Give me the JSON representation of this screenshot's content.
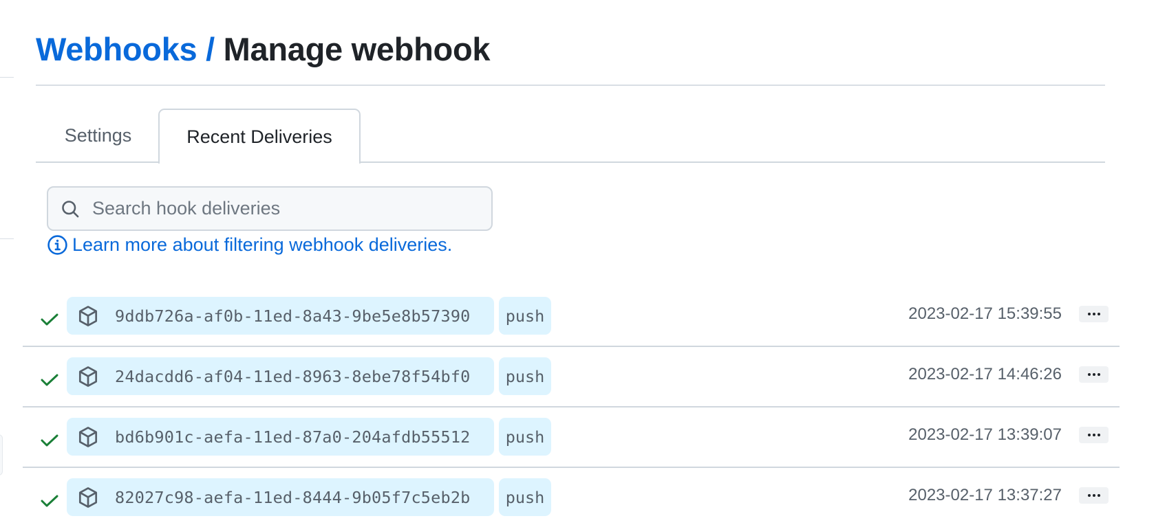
{
  "header": {
    "breadcrumb_parent": "Webhooks",
    "breadcrumb_separator": "/",
    "title": "Manage webhook"
  },
  "tabs": [
    {
      "label": "Settings",
      "active": false
    },
    {
      "label": "Recent Deliveries",
      "active": true
    }
  ],
  "search": {
    "placeholder": "Search hook deliveries",
    "value": ""
  },
  "help_link": {
    "label": "Learn more about filtering webhook deliveries.",
    "icon": "info-icon"
  },
  "deliveries": [
    {
      "status": "success",
      "status_icon": "check-icon",
      "type_icon": "package-icon",
      "guid": "9ddb726a-af0b-11ed-8a43-9be5e8b57390",
      "event": "push",
      "timestamp": "2023-02-17 15:39:55",
      "menu_icon": "kebab-horizontal-icon"
    },
    {
      "status": "success",
      "status_icon": "check-icon",
      "type_icon": "package-icon",
      "guid": "24dacdd6-af04-11ed-8963-8ebe78f54bf0",
      "event": "push",
      "timestamp": "2023-02-17 14:46:26",
      "menu_icon": "kebab-horizontal-icon"
    },
    {
      "status": "success",
      "status_icon": "check-icon",
      "type_icon": "package-icon",
      "guid": "bd6b901c-aefa-11ed-87a0-204afdb55512",
      "event": "push",
      "timestamp": "2023-02-17 13:39:07",
      "menu_icon": "kebab-horizontal-icon"
    },
    {
      "status": "success",
      "status_icon": "check-icon",
      "type_icon": "package-icon",
      "guid": "82027c98-aefa-11ed-8444-9b05f7c5eb2b",
      "event": "push",
      "timestamp": "2023-02-17 13:37:27",
      "menu_icon": "kebab-horizontal-icon"
    }
  ],
  "colors": {
    "link": "#0969da",
    "success": "#1a7f37",
    "pill_bg": "#ddf4ff",
    "muted_text": "#57606a",
    "border": "#d0d7de"
  }
}
